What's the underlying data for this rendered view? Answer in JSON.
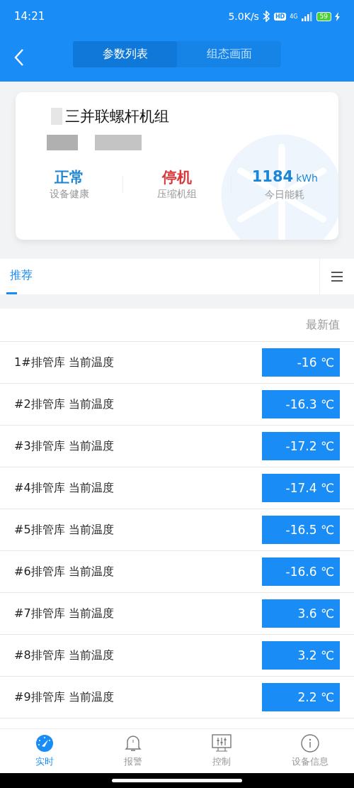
{
  "status_bar": {
    "time": "14:21",
    "speed": "5.0K/s",
    "hd": "HD",
    "network": "4G",
    "battery": "59"
  },
  "header": {
    "tabs": [
      {
        "label": "参数列表",
        "selected": true
      },
      {
        "label": "组态画面",
        "selected": false
      }
    ]
  },
  "device_card": {
    "title": "三并联螺杆机组",
    "stats": [
      {
        "value": "正常",
        "label": "设备健康",
        "color": "#1b86d6"
      },
      {
        "value": "停机",
        "label": "压缩机组",
        "color": "#d9373a"
      },
      {
        "value": "1184",
        "unit": "kWh",
        "label": "今日能耗",
        "color": "#1b86d6"
      }
    ]
  },
  "category_tabs": [
    {
      "label": "推荐",
      "selected": true
    }
  ],
  "table": {
    "column_header": "最新值",
    "rows": [
      {
        "name": "1#排管库 当前温度",
        "value": "-16 ℃"
      },
      {
        "name": "#2排管库 当前温度",
        "value": "-16.3 ℃"
      },
      {
        "name": "#3排管库 当前温度",
        "value": "-17.2 ℃"
      },
      {
        "name": "#4排管库 当前温度",
        "value": "-17.4 ℃"
      },
      {
        "name": "#5排管库 当前温度",
        "value": "-16.5 ℃"
      },
      {
        "name": "#6排管库 当前温度",
        "value": "-16.6 ℃"
      },
      {
        "name": "#7排管库 当前温度",
        "value": "3.6 ℃"
      },
      {
        "name": "#8排管库 当前温度",
        "value": "3.2 ℃"
      },
      {
        "name": "#9排管库 当前温度",
        "value": "2.2 ℃"
      }
    ]
  },
  "bottom_nav": [
    {
      "label": "实时",
      "kind": "gauge",
      "selected": true
    },
    {
      "label": "报警",
      "kind": "bell",
      "selected": false
    },
    {
      "label": "控制",
      "kind": "sliders",
      "selected": false
    },
    {
      "label": "设备信息",
      "kind": "info",
      "selected": false
    }
  ]
}
